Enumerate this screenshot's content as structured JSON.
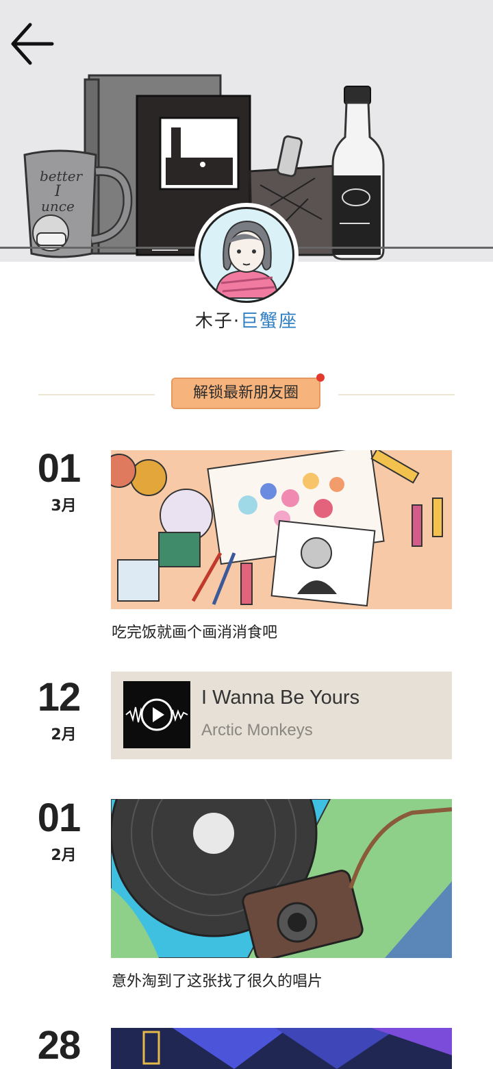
{
  "profile": {
    "name_part1": "木子·",
    "name_part2": "巨蟹座"
  },
  "unlock_button": "解锁最新朋友圈",
  "posts": [
    {
      "day": "01",
      "month": "3月",
      "caption": "吃完饭就画个画消消食吧"
    },
    {
      "day": "12",
      "month": "2月",
      "music_title": "I Wanna Be Yours",
      "music_artist": "Arctic Monkeys"
    },
    {
      "day": "01",
      "month": "2月",
      "caption": "意外淘到了这张找了很久的唱片"
    },
    {
      "day": "28"
    }
  ],
  "colors": {
    "accent_button": "#f7b37c",
    "notification_dot": "#e23b2e",
    "name_blue": "#2f7fc4"
  }
}
